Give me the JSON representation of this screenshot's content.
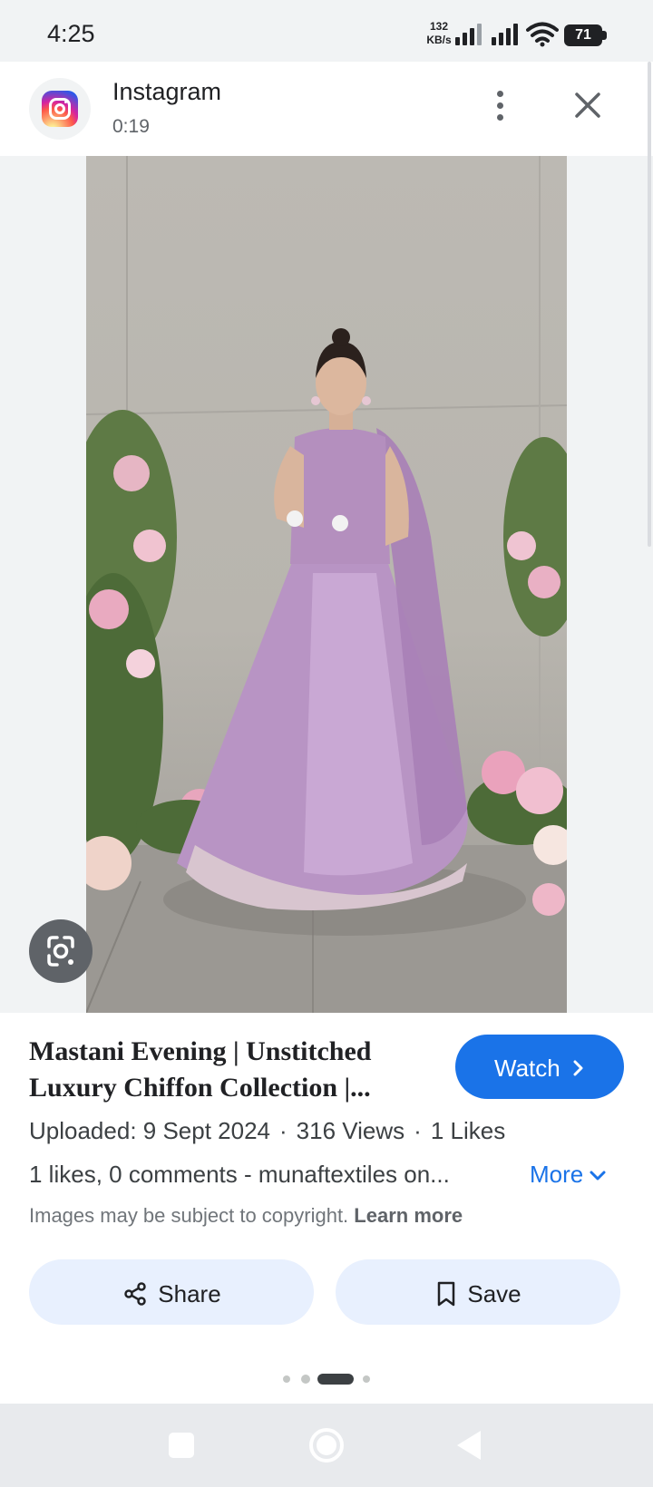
{
  "status_bar": {
    "time": "4:25",
    "net_speed_value": "132",
    "net_speed_unit": "KB/s",
    "battery_level": "71"
  },
  "header": {
    "source_name": "Instagram",
    "source_meta": "0:19",
    "source_icon": "instagram-logo",
    "more_icon": "more-vertical-icon",
    "close_icon": "close-icon"
  },
  "image": {
    "lens_icon": "google-lens-icon"
  },
  "result": {
    "title_line1": "Mastani Evening | Unstitched",
    "title_line2": "Luxury Chiffon Collection |...",
    "watch_label": "Watch",
    "uploaded": "Uploaded: 9 Sept 2024",
    "views": "316 Views",
    "likes": "1 Likes",
    "separator": "·",
    "description": "1 likes, 0 comments - munaftextiles on...",
    "more_label": "More",
    "copyright_text": "Images may be subject to copyright.",
    "learn_more": "Learn more"
  },
  "actions": {
    "share_label": "Share",
    "save_label": "Save"
  },
  "colors": {
    "accent": "#1a73e8",
    "button_bg": "#e8f0fe",
    "status_bar_bg": "#f1f3f4"
  }
}
